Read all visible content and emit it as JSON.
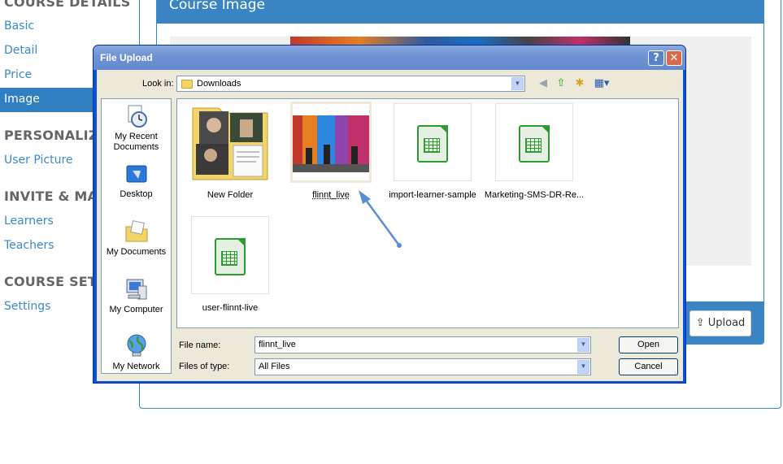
{
  "sidebar": {
    "sections": [
      {
        "title": "COURSE DETAILS",
        "items": [
          "Basic",
          "Detail",
          "Price",
          "Image"
        ]
      },
      {
        "title": "PERSONALIZE",
        "items": [
          "User Picture"
        ]
      },
      {
        "title": "INVITE & MANAGE",
        "items": [
          "Learners",
          "Teachers"
        ]
      },
      {
        "title": "COURSE SETTINGS",
        "items": [
          "Settings"
        ]
      }
    ],
    "active_item": "Image"
  },
  "panel": {
    "title": "Course Image",
    "upload_label": "Upload"
  },
  "dialog": {
    "title": "File Upload",
    "help_label": "?",
    "close_label": "✕",
    "look_in_label": "Look in:",
    "look_in_value": "Downloads",
    "places": [
      "My Recent Documents",
      "Desktop",
      "My Documents",
      "My Computer",
      "My Network"
    ],
    "files": [
      {
        "name": "New Folder",
        "icon": "folder-icon"
      },
      {
        "name": "flinnt_live",
        "icon": "image-thumbnail",
        "selected": true
      },
      {
        "name": "import-learner-sample",
        "icon": "spreadsheet-icon"
      },
      {
        "name": "Marketing-SMS-DR-Re...",
        "icon": "spreadsheet-icon"
      },
      {
        "name": "user-flinnt-live",
        "icon": "spreadsheet-icon"
      }
    ],
    "file_name_label": "File name:",
    "file_name_value": "flinnt_live",
    "file_type_label": "Files of type:",
    "file_type_value": "All Files",
    "open_label": "Open",
    "cancel_label": "Cancel"
  },
  "colors": {
    "accent": "#3a84c4",
    "link": "#3a89c9",
    "dialog_frame": "#0a52d8",
    "dialog_client": "#ece9d8",
    "annotation_arrow": "#5b8fd4"
  }
}
